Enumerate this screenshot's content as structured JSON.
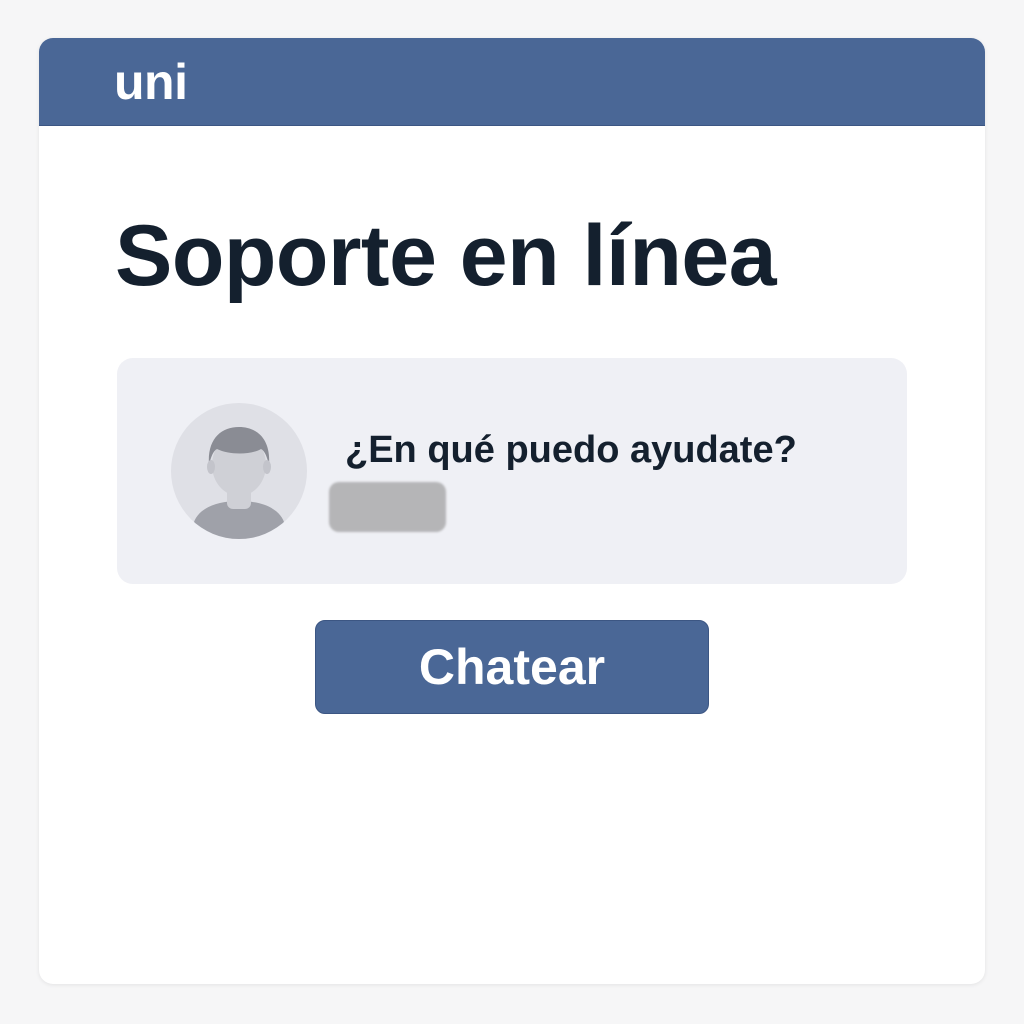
{
  "header": {
    "logo_text": "uni"
  },
  "main": {
    "title": "Soporte en línea",
    "chat_card": {
      "avatar_icon": "user-avatar-icon",
      "message": "¿En qué puedo ayudate?"
    },
    "chat_button_label": "Chatear"
  },
  "colors": {
    "brand": "#4a6796",
    "title_text": "#14202e",
    "card_background": "#eff0f5",
    "placeholder": "#b5b5b7"
  }
}
